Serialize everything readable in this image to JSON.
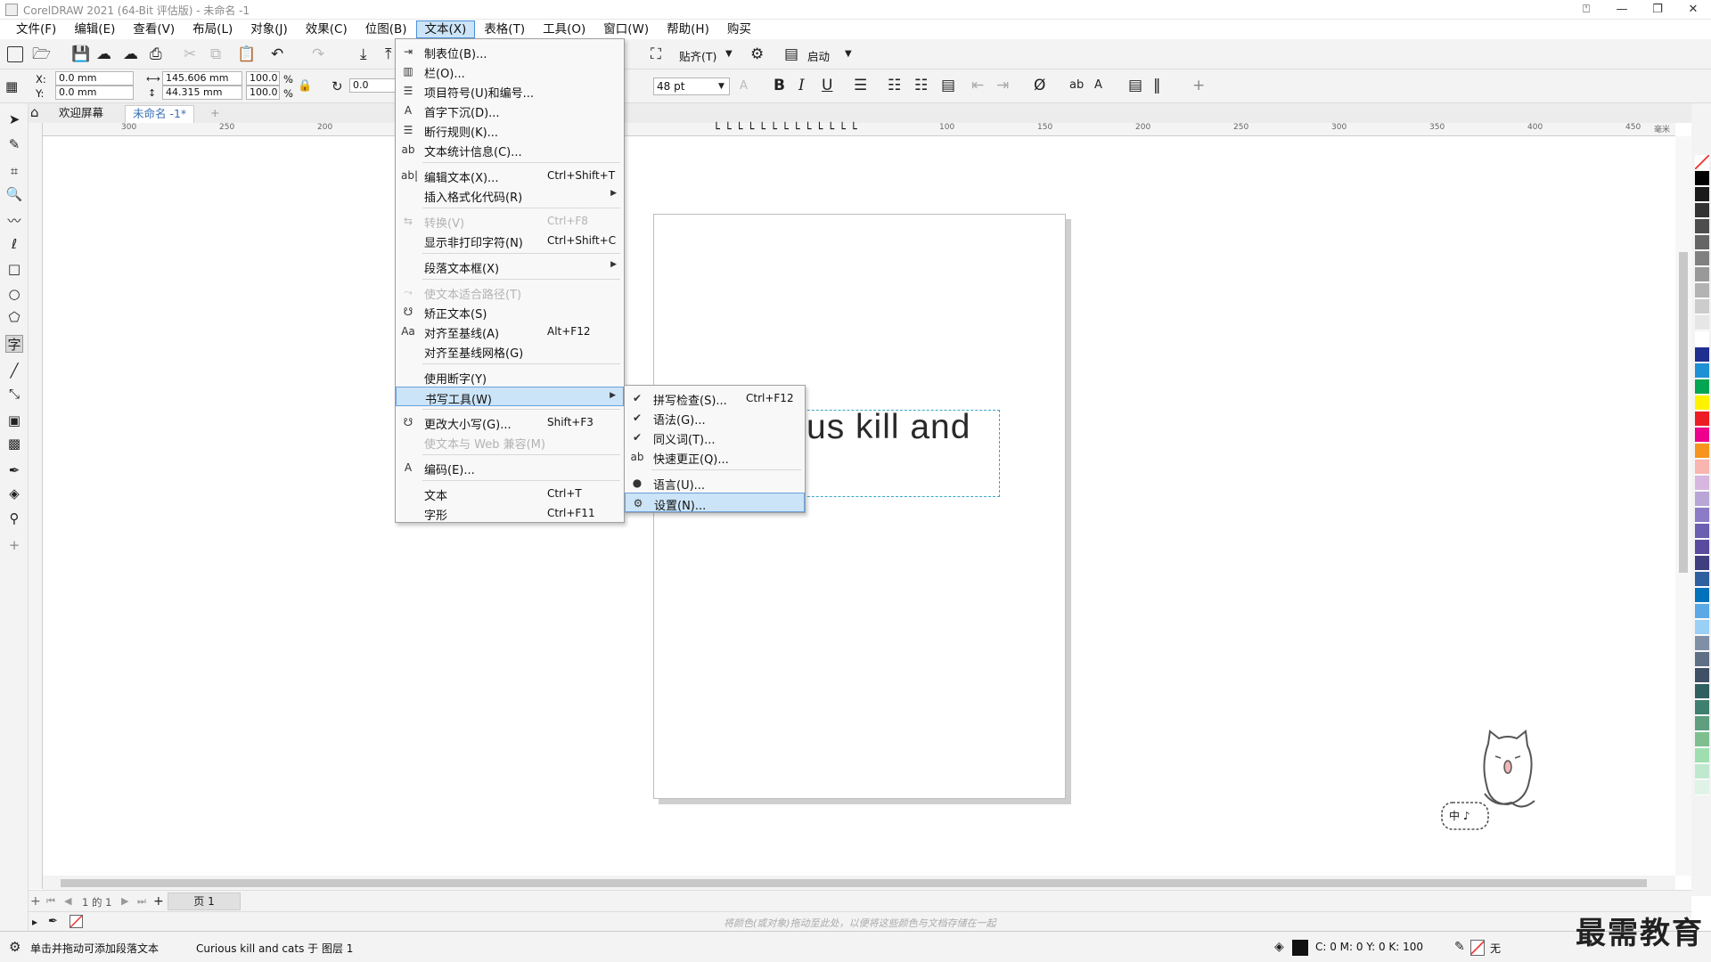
{
  "window": {
    "title": "CorelDRAW 2021 (64-Bit 评估版) - 未命名 -1",
    "controls": {
      "minimize": "—",
      "restore": "❐",
      "close": "✕",
      "help": "⍞"
    }
  },
  "menubar": [
    {
      "label": "文件(F)"
    },
    {
      "label": "编辑(E)"
    },
    {
      "label": "查看(V)"
    },
    {
      "label": "布局(L)"
    },
    {
      "label": "对象(J)"
    },
    {
      "label": "效果(C)"
    },
    {
      "label": "位图(B)"
    },
    {
      "label": "文本(X)",
      "active": true
    },
    {
      "label": "表格(T)"
    },
    {
      "label": "工具(O)"
    },
    {
      "label": "窗口(W)"
    },
    {
      "label": "帮助(H)"
    },
    {
      "label": "购买"
    }
  ],
  "toolbar1": {
    "snap_label": "贴齐(T)",
    "launch_label": "启动"
  },
  "propbar": {
    "x_label": "X:",
    "x_value": "0.0 mm",
    "y_label": "Y:",
    "y_value": "0.0 mm",
    "w_value": "145.606 mm",
    "h_value": "44.315 mm",
    "sx_value": "100.0",
    "sy_value": "100.0",
    "pct": "%",
    "rotation": "0.0",
    "font_size": "48 pt",
    "bold": "B",
    "italic": "I",
    "underline": "U"
  },
  "doctabs": {
    "welcome": "欢迎屏幕",
    "doc": "未命名 -1*",
    "add": "+"
  },
  "ruler": {
    "h_ticks": [
      "300",
      "250",
      "200",
      "100",
      "150",
      "200",
      "250",
      "300",
      "350",
      "400",
      "450"
    ],
    "unit": "毫米"
  },
  "canvas": {
    "visible_text": "us kill and"
  },
  "text_menu": {
    "items": [
      {
        "label": "制表位(B)...",
        "icon": "tab-stops-icon"
      },
      {
        "label": "栏(O)...",
        "icon": "columns-icon"
      },
      {
        "label": "项目符号(U)和编号...",
        "icon": "bullets-icon"
      },
      {
        "label": "首字下沉(D)...",
        "icon": "drop-cap-icon"
      },
      {
        "label": "断行规则(K)...",
        "icon": "line-break-icon"
      },
      {
        "label": "文本统计信息(C)...",
        "icon": "text-stats-icon",
        "sep_after": true
      },
      {
        "label": "编辑文本(X)...",
        "shortcut": "Ctrl+Shift+T",
        "icon": "edit-text-icon"
      },
      {
        "label": "插入格式化代码(R)",
        "submenu": true,
        "sep_after": true
      },
      {
        "label": "转换(V)",
        "shortcut": "Ctrl+F8",
        "disabled": true,
        "icon": "convert-icon"
      },
      {
        "label": "显示非打印字符(N)",
        "shortcut": "Ctrl+Shift+C",
        "sep_after": true
      },
      {
        "label": "段落文本框(X)",
        "submenu": true,
        "sep_after": true
      },
      {
        "label": "使文本适合路径(T)",
        "disabled": true,
        "icon": "fit-path-icon"
      },
      {
        "label": "矫正文本(S)",
        "icon": "straighten-icon"
      },
      {
        "label": "对齐至基线(A)",
        "shortcut": "Alt+F12",
        "icon": "align-baseline-icon"
      },
      {
        "label": "对齐至基线网格(G)",
        "sep_after": true
      },
      {
        "label": "使用断字(Y)"
      },
      {
        "label": "书写工具(W)",
        "submenu": true,
        "highlight": true,
        "sep_after": true
      },
      {
        "label": "更改大小写(G)...",
        "shortcut": "Shift+F3",
        "icon": "change-case-icon"
      },
      {
        "label": "使文本与 Web 兼容(M)",
        "disabled": true,
        "sep_after": true
      },
      {
        "label": "编码(E)...",
        "icon": "encoding-icon",
        "sep_after": true
      },
      {
        "label": "文本",
        "shortcut": "Ctrl+T"
      },
      {
        "label": "字形",
        "shortcut": "Ctrl+F11"
      }
    ]
  },
  "writing_tools_menu": {
    "items": [
      {
        "label": "拼写检查(S)...",
        "shortcut": "Ctrl+F12",
        "icon": "spell-check-icon"
      },
      {
        "label": "语法(G)...",
        "icon": "grammar-icon"
      },
      {
        "label": "同义词(T)...",
        "icon": "thesaurus-icon"
      },
      {
        "label": "快速更正(Q)...",
        "icon": "quick-correct-icon",
        "sep_after": true
      },
      {
        "label": "语言(U)...",
        "icon": "language-icon"
      },
      {
        "label": "设置(N)...",
        "icon": "settings-gear-icon",
        "highlight": true
      }
    ]
  },
  "pagenav": {
    "page_of": "1 的 1",
    "page_tab": "页 1"
  },
  "colorline_hint": "将颜色(或对象)拖动至此处，以便将这些颜色与文档存储在一起",
  "status": {
    "hint": "单击并拖动可添加段落文本",
    "object": "Curious kill and cats 于 图层 1",
    "fill_values": "C: 0 M: 0 Y: 0 K: 100",
    "outline": "无"
  },
  "mascot": {
    "text": "中 ♪"
  },
  "watermark": "最需教育",
  "palette": [
    "#ffffff",
    "#000000",
    "#1a1a1a",
    "#333333",
    "#4d4d4d",
    "#666666",
    "#808080",
    "#999999",
    "#b3b3b3",
    "#cccccc",
    "#e6e6e6",
    "#ffffff",
    "#1f2f8f",
    "#1e90d6",
    "#00a651",
    "#fff200",
    "#ed1c24",
    "#ec008c",
    "#f7941d",
    "#f9b5b0",
    "#d7b7e0",
    "#b7a6d6",
    "#8c7bc6",
    "#6a5fb0",
    "#5b4b9e",
    "#3f3f7f",
    "#2e5f9e",
    "#0072bc",
    "#5aa9e6",
    "#9ad0f5",
    "#7f8fa6",
    "#5f6f86",
    "#3f4f66",
    "#2f5f5f",
    "#3f7f6f",
    "#5f9f7f",
    "#7fbf8f",
    "#9fdfaf",
    "#bfe9cf",
    "#dff4e7"
  ]
}
